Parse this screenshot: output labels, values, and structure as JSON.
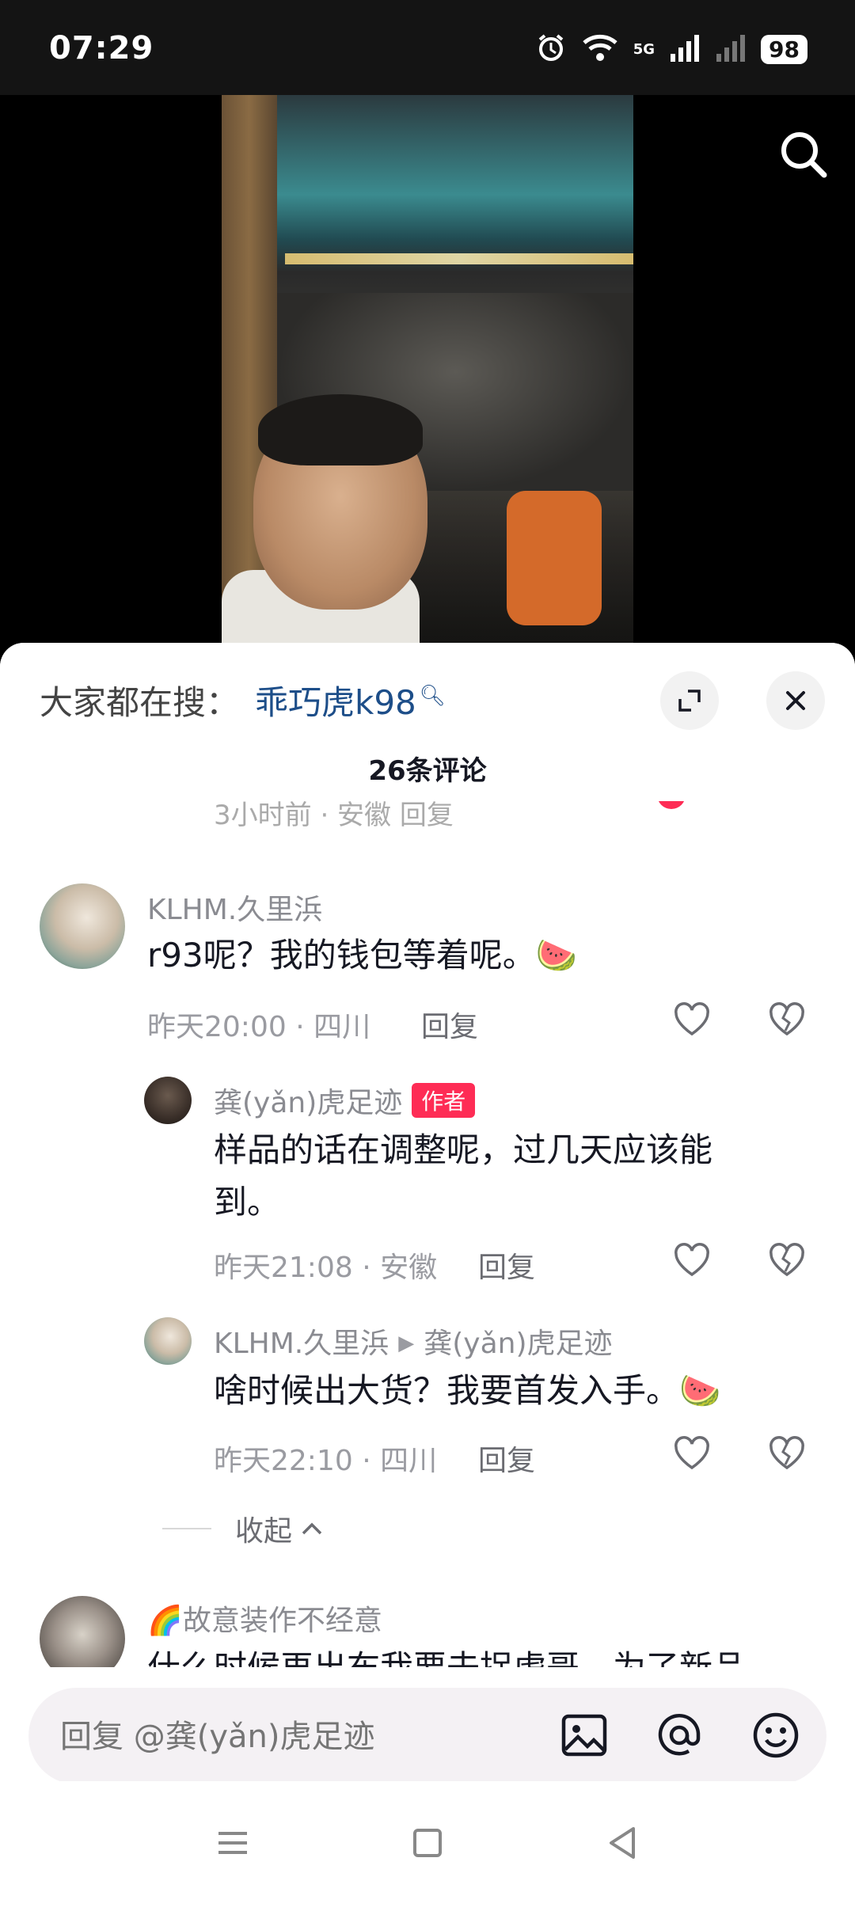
{
  "status_bar": {
    "time": "07:29",
    "network": "5G",
    "battery": "98"
  },
  "video": {
    "search_icon": "search-icon"
  },
  "sheet": {
    "trending_label": "大家都在搜：",
    "trending_term": "乖巧虎k98",
    "comment_count": "26条评论",
    "partial_row_text": "3小时前 · 安徽    回复"
  },
  "comments": [
    {
      "username": "KLHM.久里浜",
      "text": "r93呢？我的钱包等着呢。🍉",
      "time_location": "昨天20:00 · 四川",
      "reply_label": "回复"
    },
    {
      "username": "龚(yǎn)虎足迹",
      "badge": "作者",
      "text": "样品的话在调整呢，过几天应该能到。",
      "time_location": "昨天21:08 · 安徽",
      "reply_label": "回复"
    },
    {
      "username": "KLHM.久里浜",
      "reply_to": "龚(yǎn)虎足迹",
      "text": "啥时候出大货？我要首发入手。🍉",
      "time_location": "昨天22:10 · 四川",
      "reply_label": "回复"
    },
    {
      "username": "🌈故意装作不经意",
      "text": "什么时候再出布我要去捉虎哥，为了新品"
    }
  ],
  "collapse_label": "收起",
  "reply_input": {
    "placeholder": "回复 @龚(yǎn)虎足迹"
  },
  "colors": {
    "accent": "#fe2c55",
    "link": "#1d4e89"
  }
}
